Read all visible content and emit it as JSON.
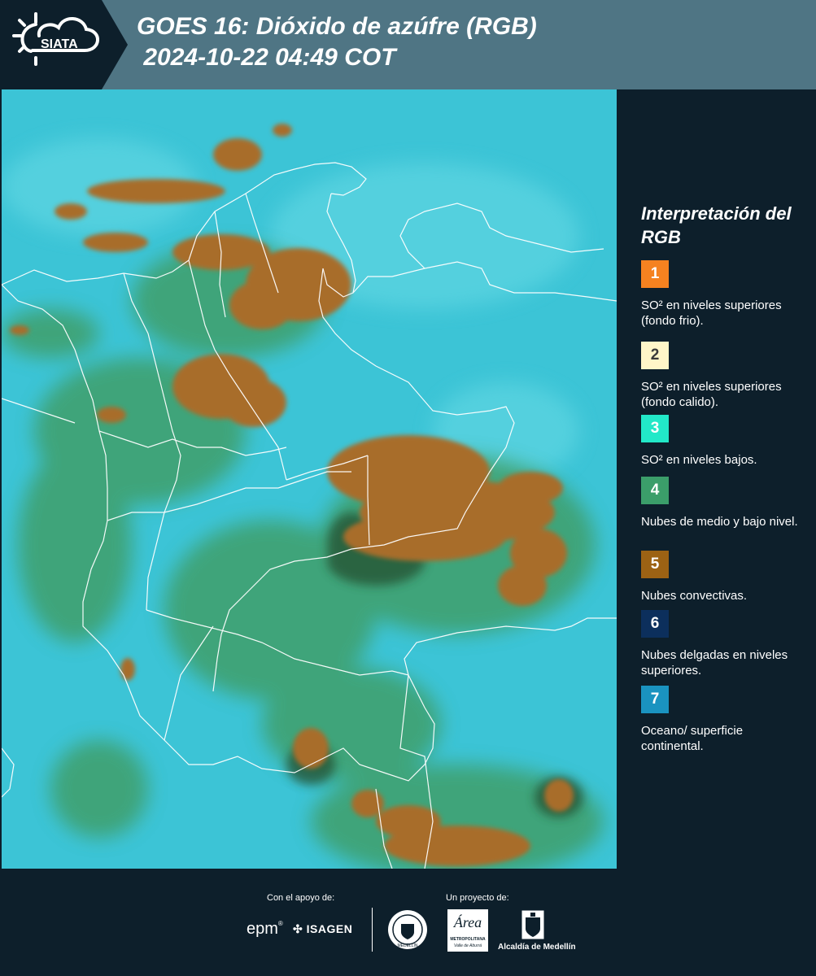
{
  "header": {
    "logo_text": "SIATA",
    "title_line1": "GOES 16: Dióxido de azúfre (RGB)",
    "title_line2": " 2024-10-22 04:49 COT"
  },
  "legend": {
    "title": "Interpretación del RGB",
    "items": [
      {
        "number": "1",
        "text": "SO² en niveles superiores (fondo frio).",
        "color": "#f58220",
        "num_color": "#ffffff"
      },
      {
        "number": "2",
        "text": "SO² en niveles superiores (fondo calido).",
        "color": "#fff6c8",
        "num_color": "#3a3a3a"
      },
      {
        "number": "3",
        "text": "SO² en niveles bajos.",
        "color": "#22e8c8",
        "num_color": "#ffffff"
      },
      {
        "number": "4",
        "text": "Nubes de medio y bajo nivel.",
        "color": "#3b9e6a",
        "num_color": "#ffffff"
      },
      {
        "number": "5",
        "text": "Nubes convectivas.",
        "color": "#9c6214",
        "num_color": "#ffffff"
      },
      {
        "number": "6",
        "text": "Nubes delgadas en niveles superiores.",
        "color": "#0c2f5c",
        "num_color": "#ffffff"
      },
      {
        "number": "7",
        "text": "Oceano/ superficie continental.",
        "color": "#1a93c0",
        "num_color": "#ffffff"
      }
    ]
  },
  "footer": {
    "support_label": "Con el apoyo de:",
    "project_label": "Un proyecto de:",
    "epm": "epm",
    "isagen": "ISAGEN",
    "area_name": "Área",
    "area_sub1": "METROPOLITANA",
    "area_sub2": "Valle de Aburrá",
    "alcaldia": "Alcaldía de Medellín",
    "seal_text": "MEDELLÍN"
  },
  "colors": {
    "header_bg": "#4f7584",
    "panel_bg": "#0d1f2b",
    "map_base": "#3cc4d6",
    "convective": "#a86d2a",
    "midlevel": "#3f9a5c"
  }
}
